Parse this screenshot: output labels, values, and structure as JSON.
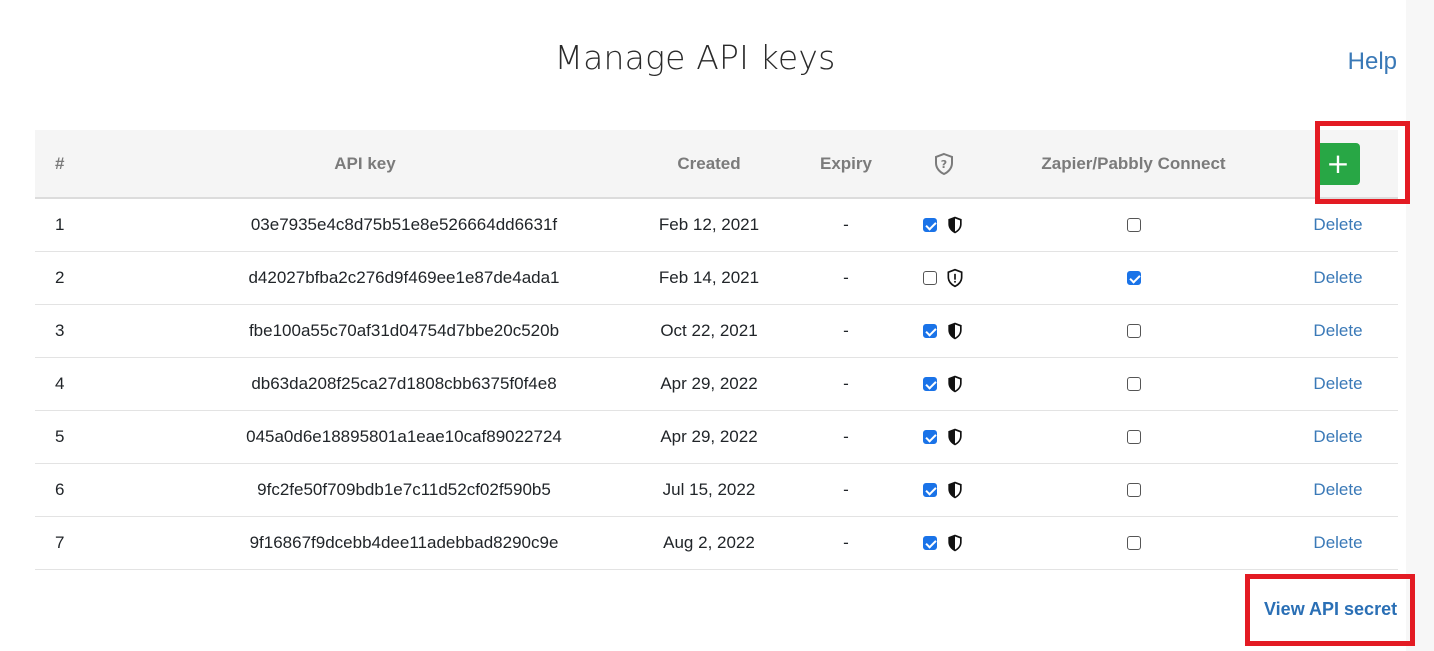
{
  "page": {
    "title": "Manage API keys",
    "help_label": "Help"
  },
  "table": {
    "headers": {
      "num": "#",
      "api_key": "API key",
      "created": "Created",
      "expiry": "Expiry",
      "security_icon": "shield-question-icon",
      "zapier": "Zapier/Pabbly Connect",
      "add_button": "+"
    },
    "rows": [
      {
        "num": "1",
        "key": "03e7935e4c8d75b51e8e526664dd6631f",
        "created": "Feb 12, 2021",
        "expiry": "-",
        "secured": true,
        "zapier": false,
        "delete_label": "Delete"
      },
      {
        "num": "2",
        "key": "d42027bfba2c276d9f469ee1e87de4ada1",
        "created": "Feb 14, 2021",
        "expiry": "-",
        "secured": false,
        "zapier": true,
        "delete_label": "Delete"
      },
      {
        "num": "3",
        "key": "fbe100a55c70af31d04754d7bbe20c520b",
        "created": "Oct 22, 2021",
        "expiry": "-",
        "secured": true,
        "zapier": false,
        "delete_label": "Delete"
      },
      {
        "num": "4",
        "key": "db63da208f25ca27d1808cbb6375f0f4e8",
        "created": "Apr 29, 2022",
        "expiry": "-",
        "secured": true,
        "zapier": false,
        "delete_label": "Delete"
      },
      {
        "num": "5",
        "key": "045a0d6e18895801a1eae10caf89022724",
        "created": "Apr 29, 2022",
        "expiry": "-",
        "secured": true,
        "zapier": false,
        "delete_label": "Delete"
      },
      {
        "num": "6",
        "key": "9fc2fe50f709bdb1e7c11d52cf02f590b5",
        "created": "Jul 15, 2022",
        "expiry": "-",
        "secured": true,
        "zapier": false,
        "delete_label": "Delete"
      },
      {
        "num": "7",
        "key": "9f16867f9dcebb4dee11adebbad8290c9e",
        "created": "Aug 2, 2022",
        "expiry": "-",
        "secured": true,
        "zapier": false,
        "delete_label": "Delete"
      }
    ]
  },
  "footer": {
    "view_secret_label": "View API secret"
  },
  "colors": {
    "accent_link": "#3a79b7",
    "add_button": "#28a745",
    "highlight_box": "#e31b23",
    "checkbox_checked": "#1a73e8"
  }
}
